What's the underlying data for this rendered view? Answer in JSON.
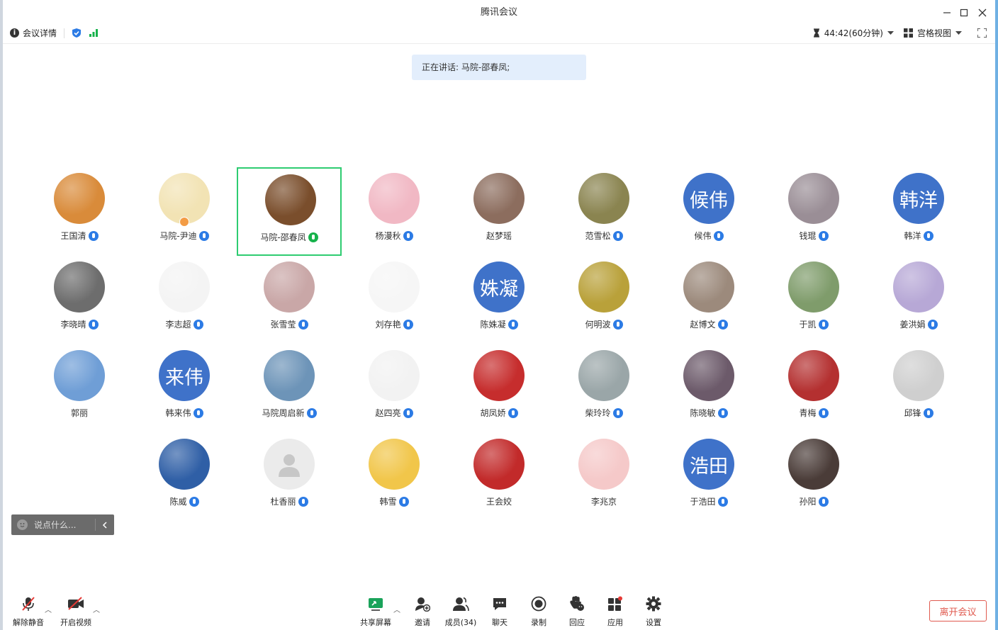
{
  "window": {
    "title": "腾讯会议"
  },
  "toolbar": {
    "meeting_info": "会议详情",
    "timer": "44:42(60分钟)",
    "view_mode": "宫格视图"
  },
  "banner": {
    "speaking_text": "正在讲话: 马院-邵春凤;"
  },
  "participants": [
    {
      "name": "王国清",
      "avatar": "photo-shiba-dog",
      "color": "#d98b3a",
      "mic": "muted"
    },
    {
      "name": "马院-尹迪",
      "avatar": "photo-cartoon-characters",
      "color": "#f2e3b4",
      "mic": "muted",
      "host": true
    },
    {
      "name": "马院-邵春凤",
      "avatar": "photo-woman-at-piano",
      "color": "#7a4e2c",
      "mic": "speaking",
      "active": true
    },
    {
      "name": "杨漫秋",
      "avatar": "photo-girl-pink",
      "color": "#f1b8c4",
      "mic": "muted"
    },
    {
      "name": "赵梦瑶",
      "avatar": "photo-child-face",
      "color": "#8c6d5e",
      "mic": "none"
    },
    {
      "name": "范雪松",
      "avatar": "photo-cat-outdoors",
      "color": "#8a8450",
      "mic": "muted"
    },
    {
      "name": "候伟",
      "avatar": "text",
      "text": "候伟",
      "mic": "muted"
    },
    {
      "name": "钱琨",
      "avatar": "photo-sunset-sky",
      "color": "#9a8e96",
      "mic": "muted"
    },
    {
      "name": "韩洋",
      "avatar": "text",
      "text": "韩洋",
      "mic": "muted"
    },
    {
      "name": "李晓晴",
      "avatar": "photo-cartoon-girl-cap",
      "color": "#6d6d6d",
      "mic": "muted"
    },
    {
      "name": "李志超",
      "avatar": "photo-calligraphy",
      "color": "#f4f4f4",
      "mic": "muted"
    },
    {
      "name": "张雪莹",
      "avatar": "photo-cat-pink-bed",
      "color": "#c9a7a7",
      "mic": "muted"
    },
    {
      "name": "刘存艳",
      "avatar": "photo-doll",
      "color": "#f6f6f6",
      "mic": "muted"
    },
    {
      "name": "陈姝凝",
      "avatar": "text",
      "text": "姝凝",
      "mic": "muted"
    },
    {
      "name": "何明波",
      "avatar": "photo-yellow-tree",
      "color": "#b9a13a",
      "mic": "muted"
    },
    {
      "name": "赵博文",
      "avatar": "photo-woman-with-cat",
      "color": "#9c8a7c",
      "mic": "muted"
    },
    {
      "name": "于凯",
      "avatar": "photo-boy-outdoors",
      "color": "#7f9c6b",
      "mic": "muted"
    },
    {
      "name": "姜洪娟",
      "avatar": "photo-cartoon-bunny",
      "color": "#b7a8d6",
      "mic": "muted"
    },
    {
      "name": "郭丽",
      "avatar": "photo-blue-sky-cloud",
      "color": "#6f9ed6",
      "mic": "none"
    },
    {
      "name": "韩来伟",
      "avatar": "text",
      "text": "来伟",
      "mic": "muted"
    },
    {
      "name": "马院周启新",
      "avatar": "photo-man-by-sea",
      "color": "#6d94b8",
      "mic": "muted"
    },
    {
      "name": "赵四亮",
      "avatar": "photo-2018-calligraphy",
      "color": "#f2f2f2",
      "mic": "muted"
    },
    {
      "name": "胡凤娇",
      "avatar": "photo-cartoon-girl-red",
      "color": "#c62d2d",
      "mic": "muted"
    },
    {
      "name": "柴玲玲",
      "avatar": "photo-ducks-on-water",
      "color": "#9aa6a8",
      "mic": "muted"
    },
    {
      "name": "陈晓敏",
      "avatar": "photo-boat-text",
      "color": "#6c5a6a",
      "mic": "muted"
    },
    {
      "name": "青梅",
      "avatar": "photo-woman-red-frame",
      "color": "#b43030",
      "mic": "muted"
    },
    {
      "name": "邱锋",
      "avatar": "photo-eagle-sketch",
      "color": "#cfcfcf",
      "mic": "muted"
    },
    {
      "name": "陈威",
      "avatar": "photo-earth",
      "color": "#2f5fa6",
      "mic": "muted"
    },
    {
      "name": "杜香丽",
      "avatar": "default",
      "mic": "muted"
    },
    {
      "name": "韩雪",
      "avatar": "photo-cartoon-giraffe",
      "color": "#f1c64a",
      "mic": "muted"
    },
    {
      "name": "王会姣",
      "avatar": "photo-china-jiayou",
      "color": "#c22a2a",
      "mic": "none"
    },
    {
      "name": "李兆京",
      "avatar": "photo-cartoon-piglet",
      "color": "#f5c9c9",
      "mic": "none"
    },
    {
      "name": "于浩田",
      "avatar": "text",
      "text": "浩田",
      "mic": "muted"
    },
    {
      "name": "孙阳",
      "avatar": "photo-girl-dark",
      "color": "#4a3c38",
      "mic": "muted"
    }
  ],
  "chat": {
    "placeholder": "说点什么..."
  },
  "controls": {
    "unmute": "解除静音",
    "start_video": "开启视频",
    "share_screen": "共享屏幕",
    "invite": "邀请",
    "members": "成员(34)",
    "chat": "聊天",
    "record": "录制",
    "react": "回应",
    "apps": "应用",
    "settings": "设置",
    "leave": "离开会议"
  },
  "colors": {
    "accent_blue": "#2c7be5",
    "speaking_green": "#16b24b",
    "active_border": "#2ecc71",
    "text_avatar_blue": "#3f72c9",
    "leave_red": "#e05a4f",
    "banner_bg": "#e3eefc"
  }
}
